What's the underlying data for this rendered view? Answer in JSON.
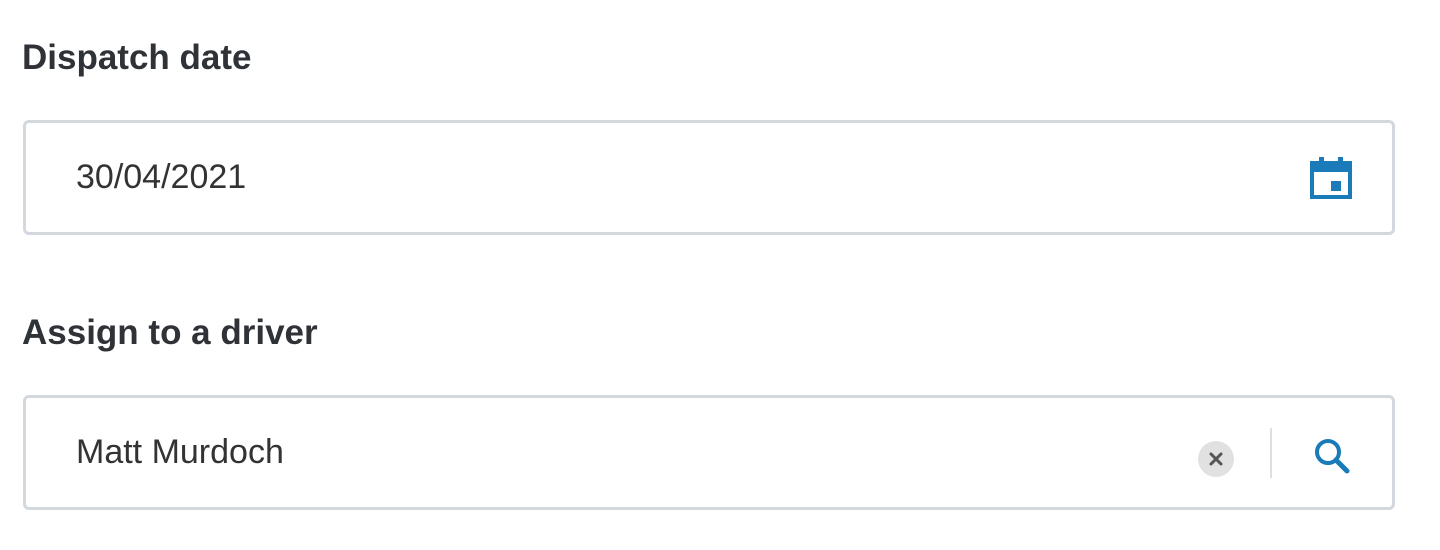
{
  "dispatch_date": {
    "label": "Dispatch date",
    "value": "30/04/2021",
    "icon": "calendar-icon"
  },
  "driver": {
    "label": "Assign to a driver",
    "value": "Matt Murdoch",
    "clear_icon": "clear-icon",
    "search_icon": "search-icon"
  },
  "colors": {
    "accent": "#1a7bb8",
    "border": "#d3d8de",
    "label": "#2f3338",
    "clear_bg": "#e1e1e1",
    "clear_x": "#555555"
  }
}
